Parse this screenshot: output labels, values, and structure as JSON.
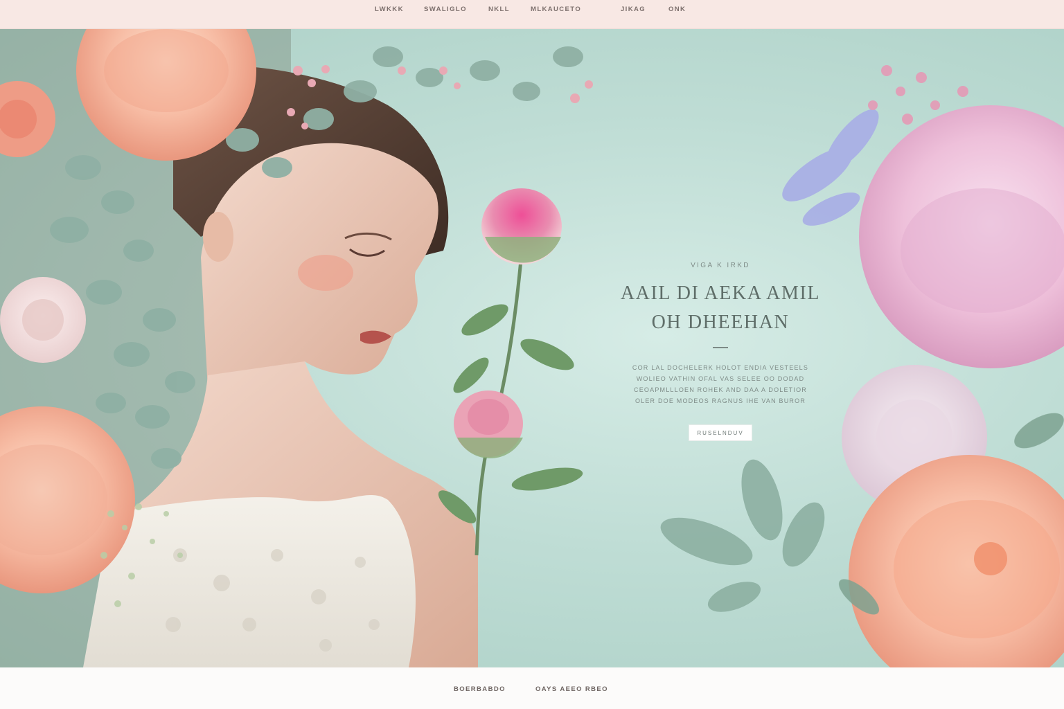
{
  "nav": {
    "items": [
      "LWKKK",
      "SWALIGLO",
      "NKLL",
      "MLKAUCETO",
      "JIKAG",
      "ONK"
    ]
  },
  "hero": {
    "eyebrow": "VIGA K IRKD",
    "headline_line1": "AAIL DI AEKA AMIL",
    "headline_line2": "OH DHEEHAN",
    "body_lines": [
      "COR LAL DOCHELERK HOLOT ENDIA VESTEELS",
      "WOLIEO VATHIN OFAL VAS SELEE OO DODAD",
      "CEOAPMLLLOEN ROHEK AND DAA A DOLETIOR",
      "OLER DOE MODEOS RAGNUS IHE VAN BUROR"
    ],
    "cta_label": "RUSELNDUV"
  },
  "footer": {
    "links": [
      "BOERBABDO",
      "OAYS AEEO RBEO"
    ]
  },
  "colors": {
    "nav_bg": "#f8e8e4",
    "hero_bg": "#bfddd5",
    "text_accent": "#5f6e69",
    "footer_bg": "#fcfbfa",
    "peony_pink": "#f2c8e0",
    "peach_rose": "#f7b89c"
  }
}
